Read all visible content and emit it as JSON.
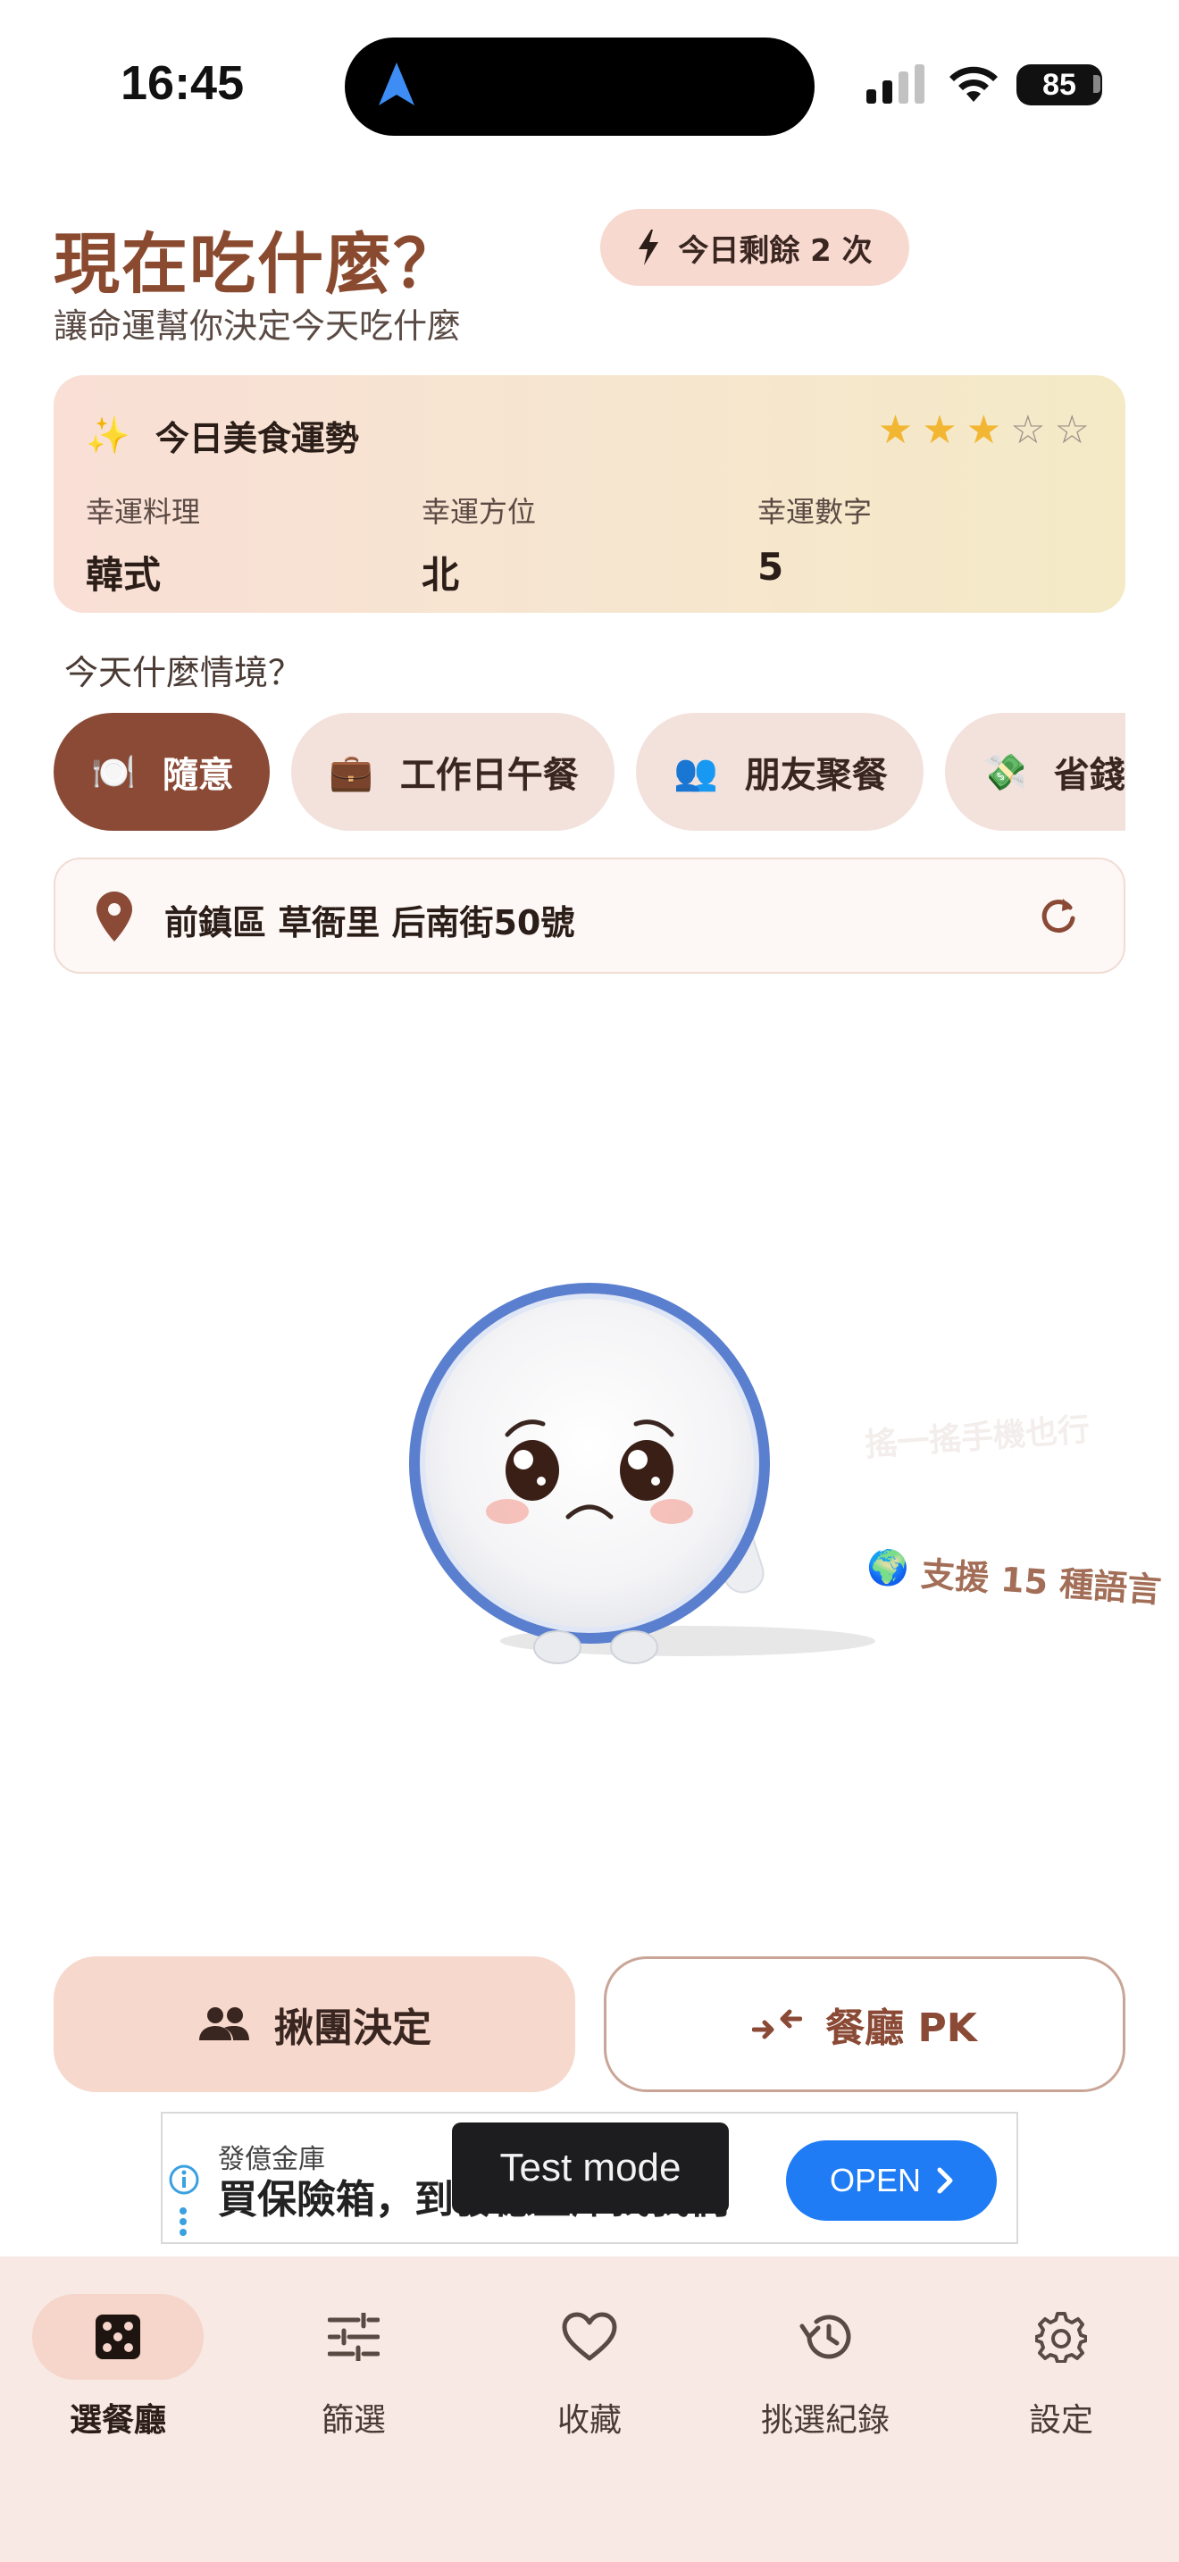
{
  "status_bar": {
    "time": "16:45",
    "battery": "85"
  },
  "header": {
    "title": "現在吃什麼？",
    "subtitle": "讓命運幫你決定今天吃什麼",
    "quota_label": "今日剩餘 2 次"
  },
  "fortune": {
    "title": "今日美食運勢",
    "rating": 3,
    "rating_max": 5,
    "items": [
      {
        "label": "幸運料理",
        "value": "韓式"
      },
      {
        "label": "幸運方位",
        "value": "北"
      },
      {
        "label": "幸運數字",
        "value": "5"
      }
    ]
  },
  "situation": {
    "label": "今天什麼情境？",
    "chips": [
      {
        "icon": "🍽️",
        "label": "隨意",
        "active": true
      },
      {
        "icon": "💼",
        "label": "工作日午餐",
        "active": false
      },
      {
        "icon": "👥",
        "label": "朋友聚餐",
        "active": false
      },
      {
        "icon": "💸",
        "label": "省錢",
        "active": false
      }
    ]
  },
  "location": {
    "address": "前鎮區 草衙里 后南街50號"
  },
  "floating": {
    "faded": "搖一搖手機也行",
    "languages": "支援 15 種語言",
    "globe": "🌍"
  },
  "actions": {
    "group_label": "揪團決定",
    "pk_label": "餐廳 PK"
  },
  "ad": {
    "brand": "發億金庫",
    "headline": "買保險箱，到發億金庫找我們",
    "open_label": "OPEN",
    "toast": "Test mode"
  },
  "nav": {
    "items": [
      {
        "label": "選餐廳",
        "active": true
      },
      {
        "label": "篩選",
        "active": false
      },
      {
        "label": "收藏",
        "active": false
      },
      {
        "label": "挑選紀錄",
        "active": false
      },
      {
        "label": "設定",
        "active": false
      }
    ]
  },
  "colors": {
    "brand": "#8a4a35",
    "accent_soft": "#f7d8cd",
    "star": "#f2b632",
    "ad_button": "#1f7cf4"
  }
}
